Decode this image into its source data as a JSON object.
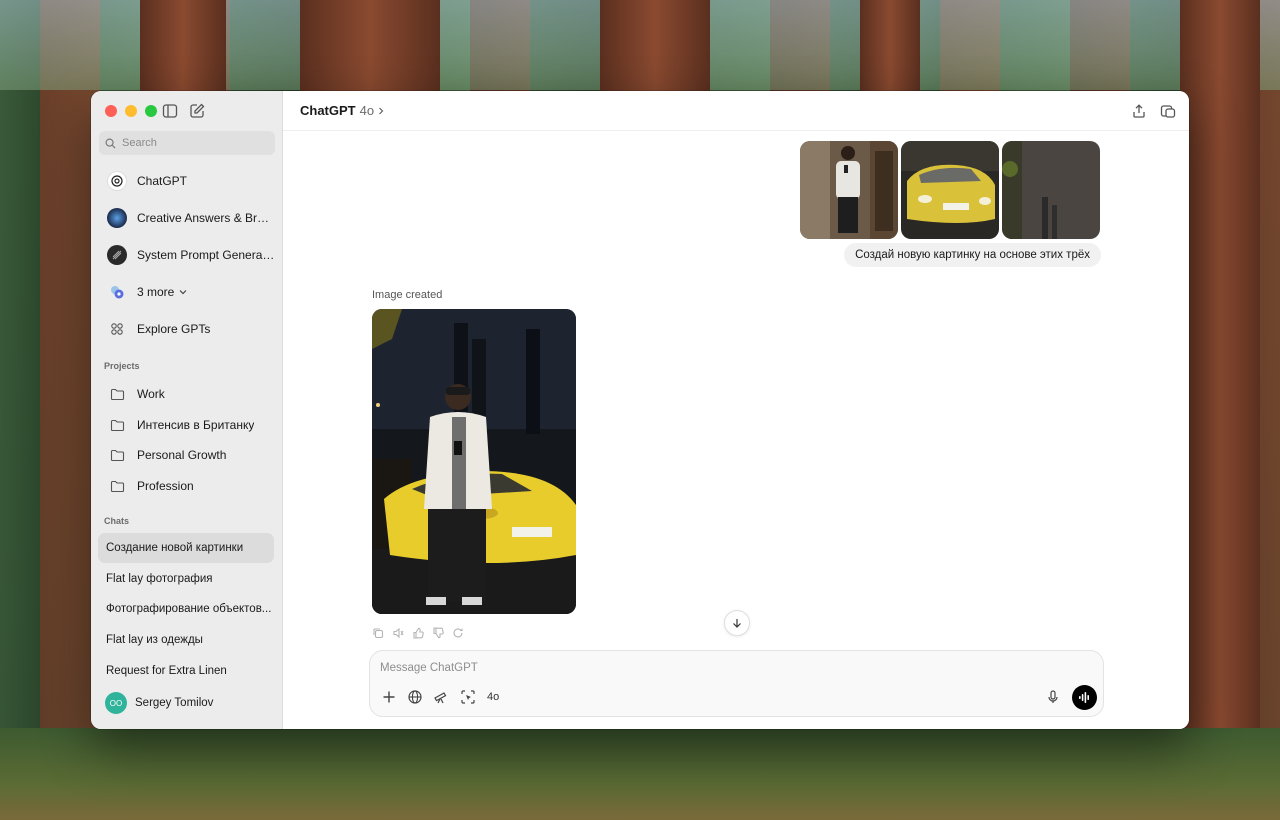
{
  "window": {
    "model_name": "ChatGPT",
    "model_version": "4o"
  },
  "sidebar": {
    "search_placeholder": "Search",
    "gpts": [
      {
        "label": "ChatGPT",
        "icon": "openai-logo-icon"
      },
      {
        "label": "Creative Answers & Brai...",
        "icon": "gpt-avatar-icon"
      },
      {
        "label": "System Prompt Generator",
        "icon": "gpt-avatar-icon"
      }
    ],
    "more_label": "3 more",
    "explore_label": "Explore GPTs",
    "projects_title": "Projects",
    "projects": [
      {
        "label": "Work"
      },
      {
        "label": "Интенсив в Британку"
      },
      {
        "label": "Personal Growth"
      },
      {
        "label": "Profession"
      }
    ],
    "chats_title": "Chats",
    "chats": [
      {
        "label": "Создание новой картинки",
        "active": true
      },
      {
        "label": "Flat lay фотография",
        "active": false
      },
      {
        "label": "Фотографирование объектов...",
        "active": false
      },
      {
        "label": "Flat lay из одежды",
        "active": false
      },
      {
        "label": "Request for Extra Linen",
        "active": false
      }
    ],
    "user": {
      "name": "Sergey Tomilov",
      "initials": "OO",
      "color": "#2fb39a"
    }
  },
  "conversation": {
    "user_message": "Создай новую картинку на основе этих трёх",
    "assistant_status": "Image created"
  },
  "composer": {
    "placeholder": "Message ChatGPT",
    "model_label": "4o"
  },
  "colors": {
    "accent": "#000000",
    "close": "#fe5f57",
    "minimize": "#febc2e",
    "zoom": "#28c840"
  }
}
